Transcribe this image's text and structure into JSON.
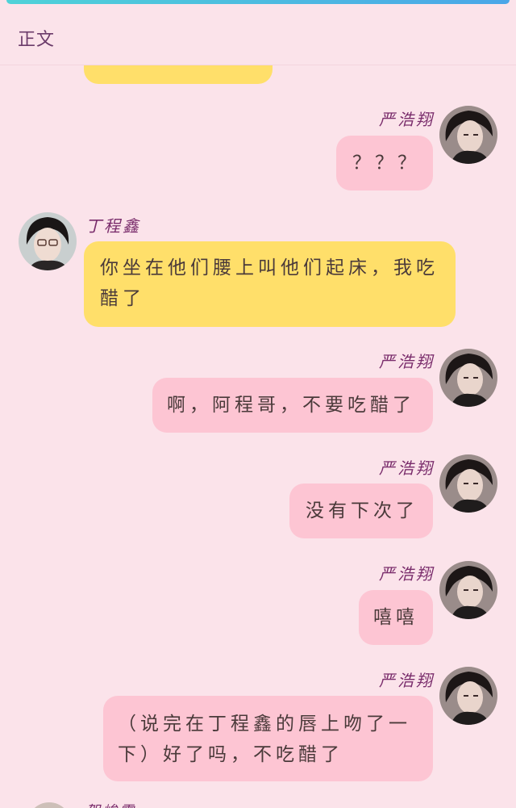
{
  "header": {
    "title": "正文"
  },
  "messages": [
    {
      "speaker": "严浩翔",
      "text": "？？？"
    },
    {
      "speaker": "丁程鑫",
      "text": "你坐在他们腰上叫他们起床，我吃醋了"
    },
    {
      "speaker": "严浩翔",
      "text": "啊，阿程哥，不要吃醋了"
    },
    {
      "speaker": "严浩翔",
      "text": "没有下次了"
    },
    {
      "speaker": "严浩翔",
      "text": "嘻嘻"
    },
    {
      "speaker": "严浩翔",
      "text": "（说完在丁程鑫的唇上吻了一下）好了吗，不吃醋了"
    }
  ],
  "partial_bottom_name": "贺峻霖",
  "colors": {
    "background": "#fbe3ea",
    "bubble_pink": "#fdc5d3",
    "bubble_yellow": "#ffdf6a",
    "name_purple": "#7a2d6c"
  }
}
